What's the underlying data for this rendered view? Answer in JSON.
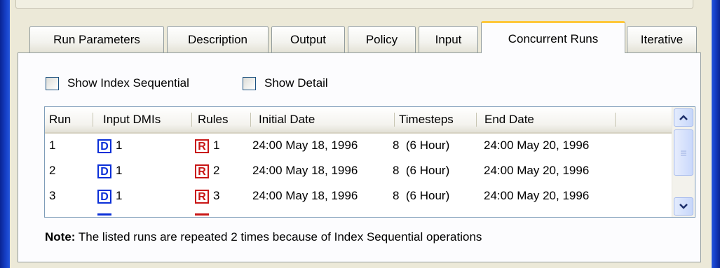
{
  "tabs": [
    {
      "label": "Run Parameters",
      "active": false
    },
    {
      "label": "Description",
      "active": false
    },
    {
      "label": "Output",
      "active": false
    },
    {
      "label": "Policy",
      "active": false
    },
    {
      "label": "Input",
      "active": false
    },
    {
      "label": "Concurrent Runs",
      "active": true
    },
    {
      "label": "Iterative",
      "active": false
    }
  ],
  "options": {
    "show_index_sequential": {
      "label": "Show Index Sequential",
      "checked": false
    },
    "show_detail": {
      "label": "Show Detail",
      "checked": false
    }
  },
  "table": {
    "columns": [
      "Run",
      "Input DMIs",
      "Rules",
      "Initial Date",
      "Timesteps",
      "End Date"
    ],
    "dmi_icon_letter": "D",
    "rule_icon_letter": "R",
    "rows": [
      {
        "run": "1",
        "dmi": "1",
        "rule": "1",
        "initial_date": "24:00 May 18, 1996",
        "timesteps": "8  (6 Hour)",
        "end_date": "24:00 May 20, 1996"
      },
      {
        "run": "2",
        "dmi": "1",
        "rule": "2",
        "initial_date": "24:00 May 18, 1996",
        "timesteps": "8  (6 Hour)",
        "end_date": "24:00 May 20, 1996"
      },
      {
        "run": "3",
        "dmi": "1",
        "rule": "3",
        "initial_date": "24:00 May 18, 1996",
        "timesteps": "8  (6 Hour)",
        "end_date": "24:00 May 20, 1996"
      }
    ]
  },
  "note": {
    "bold": "Note:",
    "text": " The listed runs are repeated 2 times because of Index Sequential operations"
  },
  "icons": {
    "scroll_up": "chevron-up-icon",
    "scroll_down": "chevron-down-icon",
    "thumb_grip": "grip-icon"
  },
  "colors": {
    "dmi_blue": "#0a2fd8",
    "rule_red": "#c81616",
    "active_tab_accent": "#ffc83c",
    "window_frame": "#0c2c9e"
  }
}
